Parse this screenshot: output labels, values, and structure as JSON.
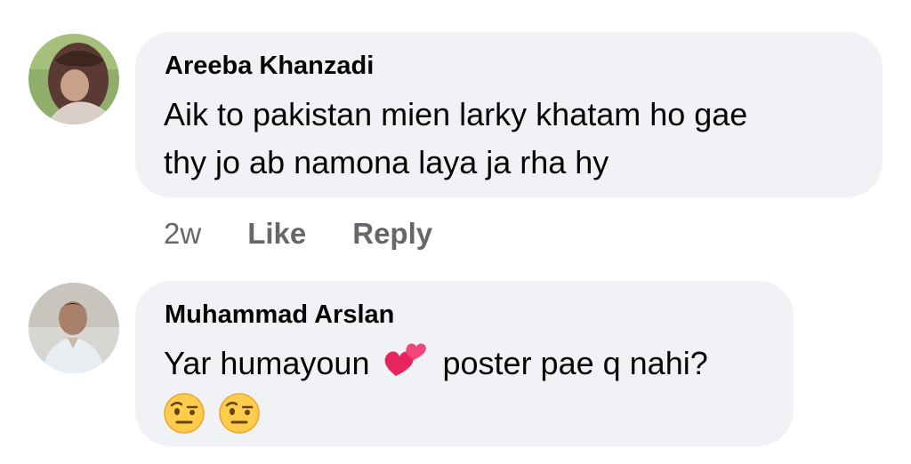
{
  "comments": [
    {
      "author": "Areeba Khanzadi",
      "text_line_1": "Aik to pakistan mien larky khatam ho gae",
      "text_line_2": "thy jo ab namona laya ja rha hy",
      "time": "2w",
      "like_label": "Like",
      "reply_label": "Reply"
    },
    {
      "author": "Muhammad Arslan",
      "text_before_emoji": "Yar humayoun",
      "emoji_inline": "two-hearts-icon",
      "text_after_emoji": "poster pae q nahi?",
      "emoji_line": [
        "raised-eyebrow-face-icon",
        "raised-eyebrow-face-icon"
      ]
    }
  ],
  "colors": {
    "bubble_bg": "#f0f2f5",
    "author_text": "#050505",
    "meta_text": "#65676b"
  }
}
